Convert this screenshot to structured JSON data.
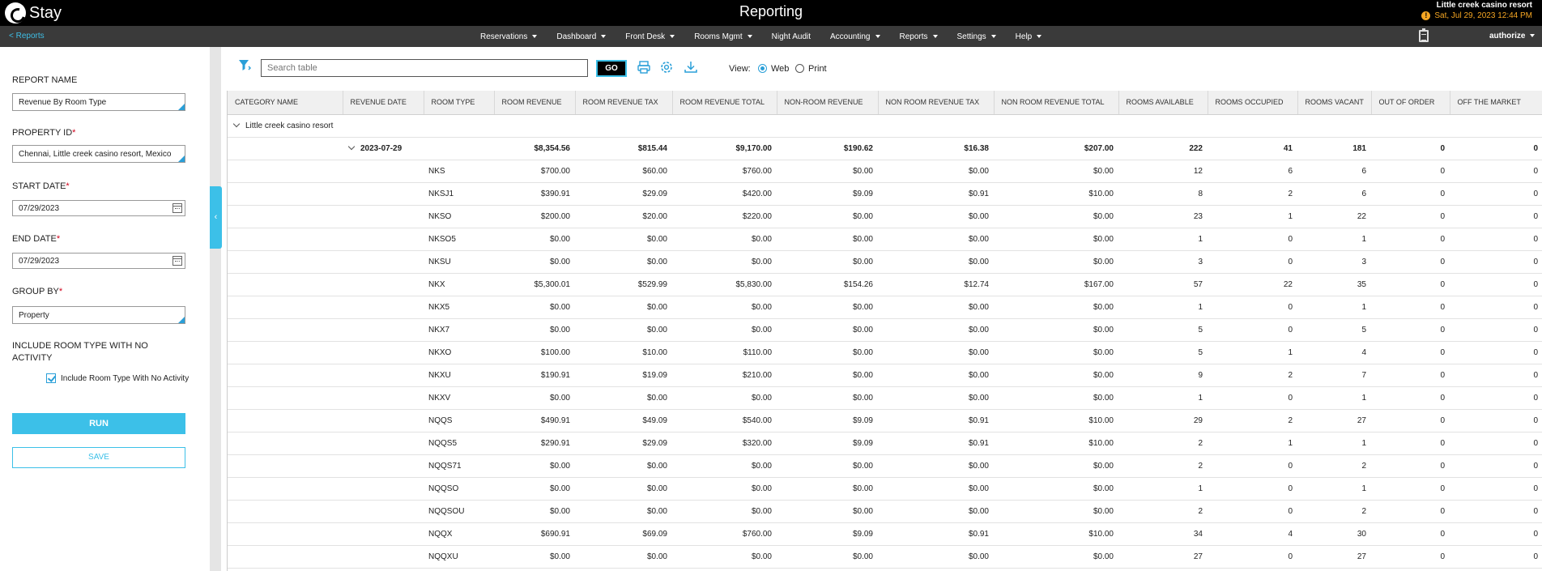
{
  "topbar": {
    "logo_text": "Stay",
    "title": "Reporting",
    "resort_name": "Little creek casino resort",
    "datetime": "Sat, Jul 29, 2023 12:44 PM"
  },
  "nav": {
    "back_link": "< Reports",
    "items": [
      "Reservations",
      "Dashboard",
      "Front Desk",
      "Rooms Mgmt",
      "Night Audit",
      "Accounting",
      "Reports",
      "Settings",
      "Help"
    ],
    "user": "authorize"
  },
  "form": {
    "report_name_label": "Report Name",
    "report_name_value": "Revenue By Room Type",
    "property_id_label": "Property ID",
    "property_id_value": "Chennai, Little creek casino resort, Mexico",
    "start_date_label": "Start Date",
    "start_date_value": "07/29/2023",
    "end_date_label": "End Date",
    "end_date_value": "07/29/2023",
    "group_by_label": "Group By",
    "group_by_value": "Property",
    "include_label": "Include Room Type With No Activity",
    "include_checkbox_label": "Include Room Type With No Activity",
    "include_checked": true,
    "run_label": "RUN",
    "save_label": "SAVE",
    "required_mark": "*"
  },
  "toolbar": {
    "search_placeholder": "Search table",
    "go_label": "GO",
    "view_label": "View:",
    "view_web": "Web",
    "view_print": "Print",
    "view_selected": "Web"
  },
  "table": {
    "columns": [
      "Category Name",
      "Revenue Date",
      "Room Type",
      "Room Revenue",
      "Room Revenue Tax",
      "Room Revenue Total",
      "Non-Room Revenue",
      "Non Room Revenue Tax",
      "Non Room Revenue Total",
      "Rooms Available",
      "Rooms Occupied",
      "Rooms Vacant",
      "Out Of Order",
      "Off The Market"
    ],
    "group": "Little creek casino resort",
    "subtotal": {
      "date": "2023-07-29",
      "values": [
        "$8,354.56",
        "$815.44",
        "$9,170.00",
        "$190.62",
        "$16.38",
        "$207.00",
        "222",
        "41",
        "181",
        "0",
        "0"
      ]
    },
    "rows": [
      {
        "room_type": "NKS",
        "values": [
          "$700.00",
          "$60.00",
          "$760.00",
          "$0.00",
          "$0.00",
          "$0.00",
          "12",
          "6",
          "6",
          "0",
          "0"
        ]
      },
      {
        "room_type": "NKSJ1",
        "values": [
          "$390.91",
          "$29.09",
          "$420.00",
          "$9.09",
          "$0.91",
          "$10.00",
          "8",
          "2",
          "6",
          "0",
          "0"
        ]
      },
      {
        "room_type": "NKSO",
        "values": [
          "$200.00",
          "$20.00",
          "$220.00",
          "$0.00",
          "$0.00",
          "$0.00",
          "23",
          "1",
          "22",
          "0",
          "0"
        ]
      },
      {
        "room_type": "NKSO5",
        "values": [
          "$0.00",
          "$0.00",
          "$0.00",
          "$0.00",
          "$0.00",
          "$0.00",
          "1",
          "0",
          "1",
          "0",
          "0"
        ]
      },
      {
        "room_type": "NKSU",
        "values": [
          "$0.00",
          "$0.00",
          "$0.00",
          "$0.00",
          "$0.00",
          "$0.00",
          "3",
          "0",
          "3",
          "0",
          "0"
        ]
      },
      {
        "room_type": "NKX",
        "values": [
          "$5,300.01",
          "$529.99",
          "$5,830.00",
          "$154.26",
          "$12.74",
          "$167.00",
          "57",
          "22",
          "35",
          "0",
          "0"
        ]
      },
      {
        "room_type": "NKX5",
        "values": [
          "$0.00",
          "$0.00",
          "$0.00",
          "$0.00",
          "$0.00",
          "$0.00",
          "1",
          "0",
          "1",
          "0",
          "0"
        ]
      },
      {
        "room_type": "NKX7",
        "values": [
          "$0.00",
          "$0.00",
          "$0.00",
          "$0.00",
          "$0.00",
          "$0.00",
          "5",
          "0",
          "5",
          "0",
          "0"
        ]
      },
      {
        "room_type": "NKXO",
        "values": [
          "$100.00",
          "$10.00",
          "$110.00",
          "$0.00",
          "$0.00",
          "$0.00",
          "5",
          "1",
          "4",
          "0",
          "0"
        ]
      },
      {
        "room_type": "NKXU",
        "values": [
          "$190.91",
          "$19.09",
          "$210.00",
          "$0.00",
          "$0.00",
          "$0.00",
          "9",
          "2",
          "7",
          "0",
          "0"
        ]
      },
      {
        "room_type": "NKXV",
        "values": [
          "$0.00",
          "$0.00",
          "$0.00",
          "$0.00",
          "$0.00",
          "$0.00",
          "1",
          "0",
          "1",
          "0",
          "0"
        ]
      },
      {
        "room_type": "NQQS",
        "values": [
          "$490.91",
          "$49.09",
          "$540.00",
          "$9.09",
          "$0.91",
          "$10.00",
          "29",
          "2",
          "27",
          "0",
          "0"
        ]
      },
      {
        "room_type": "NQQS5",
        "values": [
          "$290.91",
          "$29.09",
          "$320.00",
          "$9.09",
          "$0.91",
          "$10.00",
          "2",
          "1",
          "1",
          "0",
          "0"
        ]
      },
      {
        "room_type": "NQQS71",
        "values": [
          "$0.00",
          "$0.00",
          "$0.00",
          "$0.00",
          "$0.00",
          "$0.00",
          "2",
          "0",
          "2",
          "0",
          "0"
        ]
      },
      {
        "room_type": "NQQSO",
        "values": [
          "$0.00",
          "$0.00",
          "$0.00",
          "$0.00",
          "$0.00",
          "$0.00",
          "1",
          "0",
          "1",
          "0",
          "0"
        ]
      },
      {
        "room_type": "NQQSOU",
        "values": [
          "$0.00",
          "$0.00",
          "$0.00",
          "$0.00",
          "$0.00",
          "$0.00",
          "2",
          "0",
          "2",
          "0",
          "0"
        ]
      },
      {
        "room_type": "NQQX",
        "values": [
          "$690.91",
          "$69.09",
          "$760.00",
          "$9.09",
          "$0.91",
          "$10.00",
          "34",
          "4",
          "30",
          "0",
          "0"
        ]
      },
      {
        "room_type": "NQQXU",
        "values": [
          "$0.00",
          "$0.00",
          "$0.00",
          "$0.00",
          "$0.00",
          "$0.00",
          "27",
          "0",
          "27",
          "0",
          "0"
        ]
      }
    ]
  },
  "colors": {
    "accent": "#3cc0e8",
    "topbar": "#000000",
    "navbar": "#3a3a3a",
    "warning": "#f5a623",
    "required": "#d0021b"
  },
  "icons": {
    "filter": "filter-icon",
    "print": "print-icon",
    "settings": "gear-icon",
    "download": "download-icon",
    "calendar": "calendar-icon",
    "clipboard": "clipboard-icon",
    "warning": "warning-icon"
  }
}
